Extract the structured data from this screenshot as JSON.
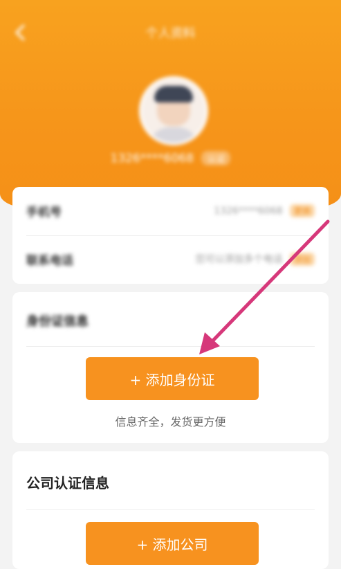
{
  "nav": {
    "title": "个人资料"
  },
  "profile": {
    "username": "1326****6068",
    "badge": "认证"
  },
  "account": {
    "rows": [
      {
        "label": "手机号",
        "value": "1326****6068",
        "tag": "更换"
      },
      {
        "label": "联系电话",
        "value": "您可以添加多个电话",
        "tag": "添加"
      }
    ]
  },
  "id_section": {
    "title": "身份证信息",
    "button_label": "+ 添加身份证",
    "hint": "信息齐全，发货更方便"
  },
  "company_section": {
    "title": "公司认证信息",
    "button_label": "+ 添加公司"
  },
  "colors": {
    "accent": "#f7921f",
    "header": "#f8a21f",
    "arrow": "#d6387a"
  }
}
